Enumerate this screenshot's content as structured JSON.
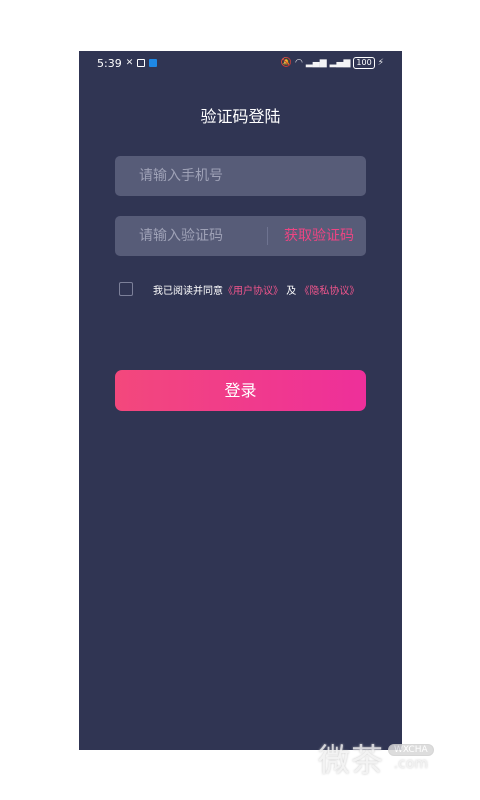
{
  "status_bar": {
    "time": "5:39",
    "battery": "100"
  },
  "page": {
    "title": "验证码登陆"
  },
  "phone_field": {
    "placeholder": "请输入手机号"
  },
  "code_field": {
    "placeholder": "请输入验证码",
    "get_code_label": "获取验证码"
  },
  "agreement": {
    "prefix": "我已阅读并同意",
    "user_agreement": "《用户协议》",
    "and": "及",
    "privacy_agreement": "《隐私协议》"
  },
  "login_button": {
    "label": "登录"
  },
  "watermark": {
    "text": "微茶",
    "badge": "WXCHA",
    "domain": ".com"
  },
  "colors": {
    "background": "#303553",
    "field": "#575c78",
    "accent": "#ec4583"
  }
}
